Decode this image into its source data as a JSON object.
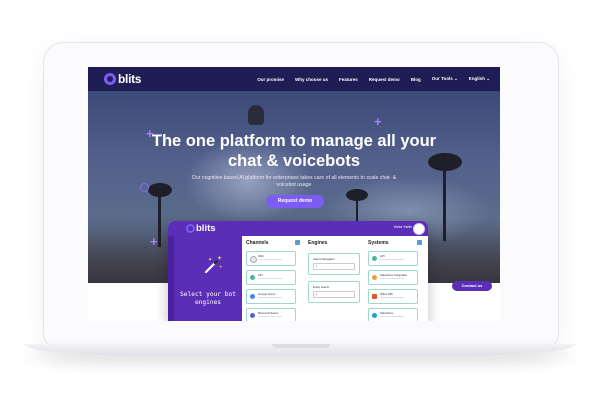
{
  "nav": {
    "logo_text": "blits",
    "links": [
      "Our promise",
      "Why choose us",
      "Features",
      "Request demo",
      "Blog",
      "Our Tools ⌄",
      "English ⌄"
    ]
  },
  "hero": {
    "title": "The one platform to manage all your chat & voicebots",
    "subtitle": "Our cognitive based AI platform for enterprises takes care of all elements to scale chat- & voicebot usage",
    "cta": "Request demo"
  },
  "app": {
    "logo_text": "blits",
    "user_label": "Visitor Kahle",
    "side_text": "Select your bot engines",
    "columns": {
      "channels": {
        "title": "Channels",
        "cards": [
          "Web",
          "API",
          "Google Home",
          "Microsoft Teams"
        ]
      },
      "engines": {
        "title": "Engines",
        "cards": [
          "Select Navigation",
          "Entity search"
        ]
      },
      "systems": {
        "title": "Systems",
        "cards": [
          "API",
          "Salesforce Integration",
          "Office 365",
          "Salesforce"
        ]
      }
    }
  },
  "contact_button": "Contact us",
  "colors": {
    "nav_bg": "#1f1d55",
    "accent": "#7b5cf4",
    "app_purple": "#5b2eb8"
  }
}
